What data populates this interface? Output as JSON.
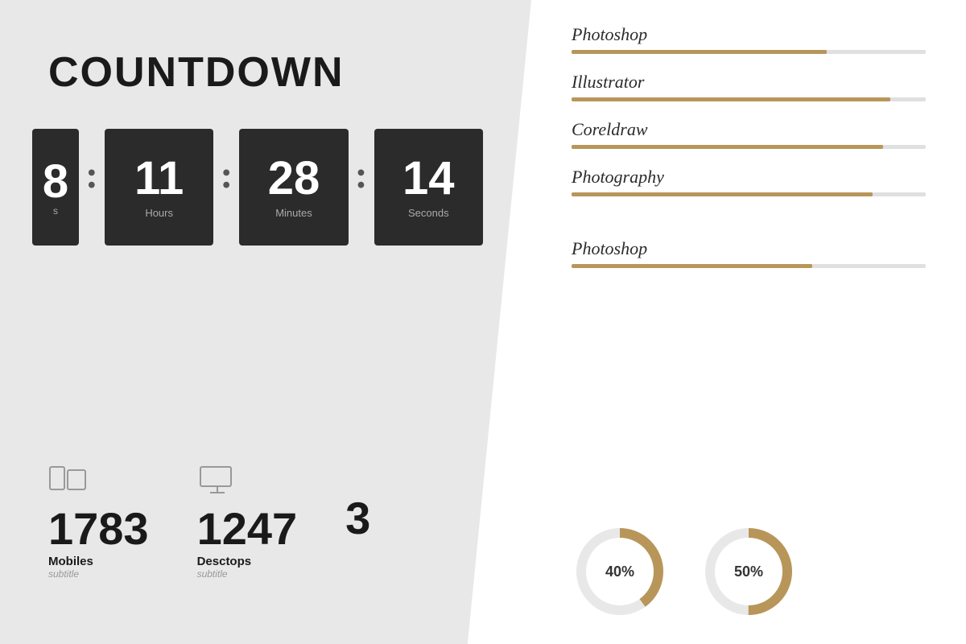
{
  "left": {
    "title": "COUNTDOWN",
    "units": [
      {
        "value": "8",
        "label": "Days",
        "partial": true
      },
      {
        "value": "11",
        "label": "Hours"
      },
      {
        "value": "28",
        "label": "Minutes"
      },
      {
        "value": "14",
        "label": "Seconds"
      }
    ],
    "stats": [
      {
        "icon": "mobile-icon",
        "number": "1783",
        "label": "Mobiles",
        "subtitle": "subtitle"
      },
      {
        "icon": "desktop-icon",
        "number": "1247",
        "label": "Desctops",
        "subtitle": "subtitle"
      },
      {
        "icon": "tablet-icon",
        "number": "3",
        "label": "",
        "subtitle": "",
        "partial": true
      }
    ]
  },
  "right": {
    "skills": [
      {
        "name": "Photoshop",
        "percent": 72
      },
      {
        "name": "Illustrator",
        "percent": 90
      },
      {
        "name": "Coreldraw",
        "percent": 88
      },
      {
        "name": "Photography",
        "percent": 85
      },
      {
        "name": "Photoshop",
        "percent": 68
      }
    ],
    "donuts": [
      {
        "label": "40%",
        "percent": 40
      },
      {
        "label": "50%",
        "percent": 50
      }
    ]
  }
}
